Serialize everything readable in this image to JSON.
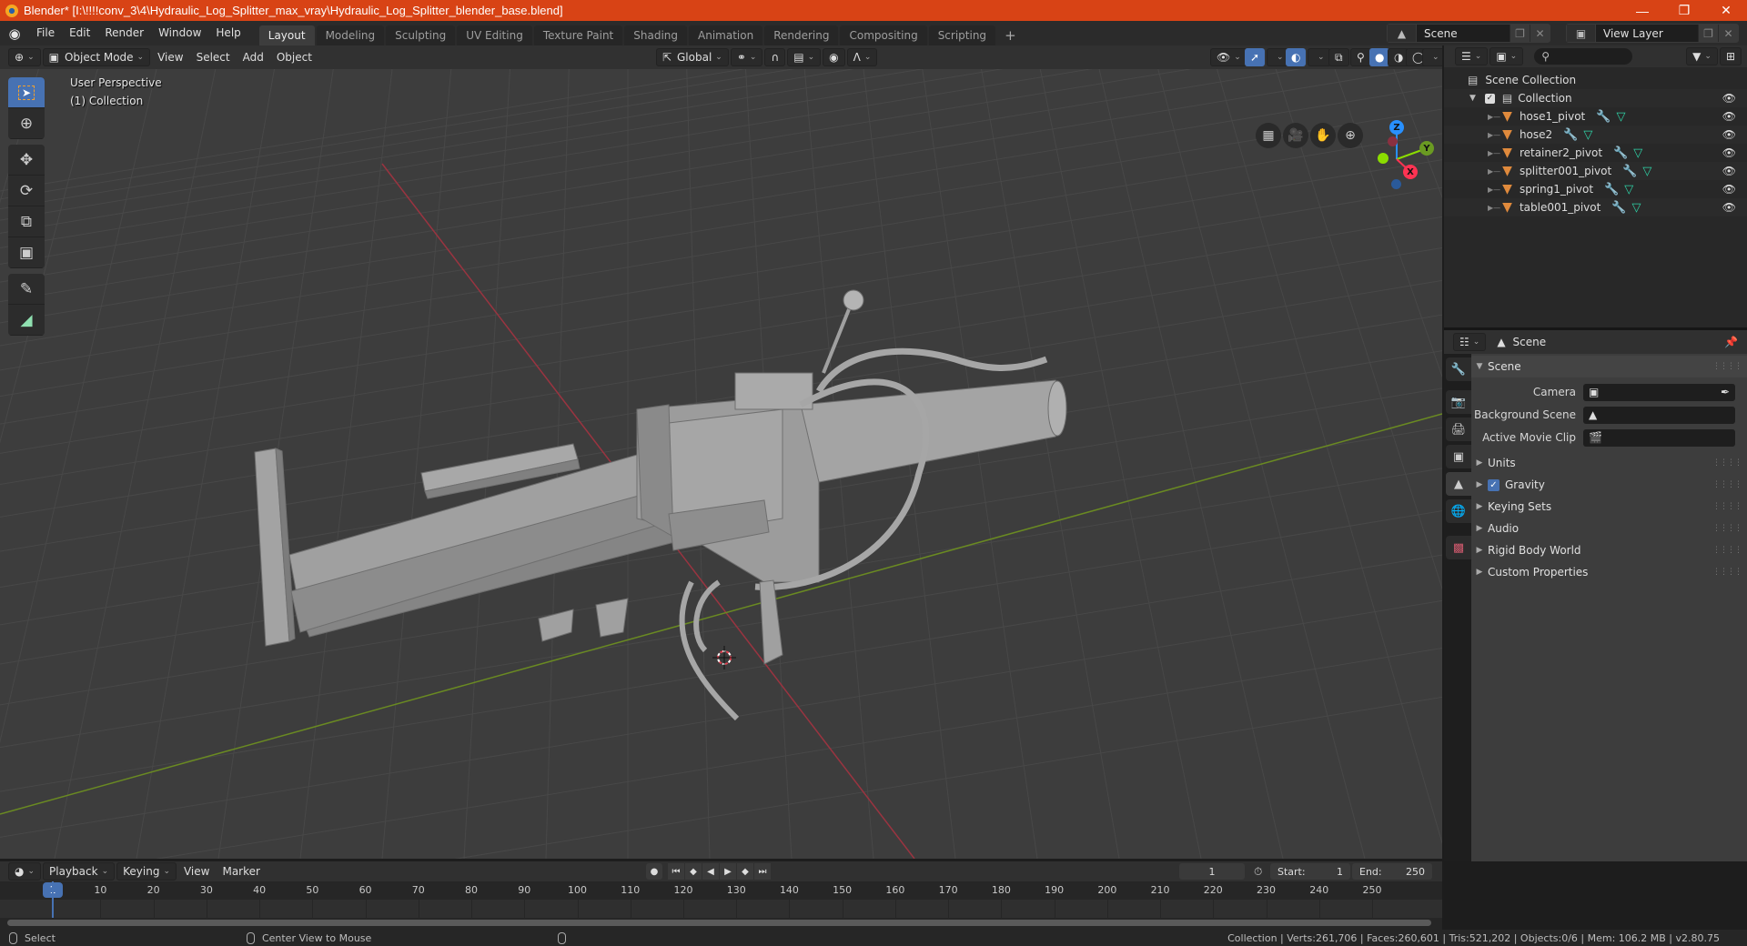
{
  "window": {
    "title": "Blender* [I:\\!!!!conv_3\\4\\Hydraulic_Log_Splitter_max_vray\\Hydraulic_Log_Splitter_blender_base.blend]",
    "controls": {
      "minimize": "—",
      "maximize": "❐",
      "close": "✕"
    }
  },
  "menubar": {
    "items": [
      "File",
      "Edit",
      "Render",
      "Window",
      "Help"
    ],
    "workspaces": [
      "Layout",
      "Modeling",
      "Sculpting",
      "UV Editing",
      "Texture Paint",
      "Shading",
      "Animation",
      "Rendering",
      "Compositing",
      "Scripting"
    ],
    "active_workspace": "Layout",
    "add_workspace": "+",
    "scene": "Scene",
    "view_layer": "View Layer"
  },
  "viewport": {
    "mode": "Object Mode",
    "menus": [
      "View",
      "Select",
      "Add",
      "Object"
    ],
    "transform_orientation": "Global",
    "overlay_text": [
      "User Perspective",
      "(1) Collection"
    ],
    "gizmo_axes": {
      "x": "X",
      "y": "Y",
      "z": "Z"
    },
    "axis_colors": {
      "x": "#ff3352",
      "y": "#8bdc00",
      "z": "#2890ff"
    },
    "object_color": "#9a9a9a"
  },
  "outliner": {
    "search_placeholder": "",
    "root": "Scene Collection",
    "collection": "Collection",
    "objects": [
      "hose1_pivot",
      "hose2",
      "retainer2_pivot",
      "splitter001_pivot",
      "spring1_pivot",
      "table001_pivot"
    ]
  },
  "properties": {
    "context": "Scene",
    "panel_title": "Scene",
    "fields": [
      {
        "label": "Camera",
        "value": ""
      },
      {
        "label": "Background Scene",
        "value": ""
      },
      {
        "label": "Active Movie Clip",
        "value": ""
      }
    ],
    "subpanels": [
      {
        "label": "Units"
      },
      {
        "label": "Gravity",
        "checked": true
      },
      {
        "label": "Keying Sets"
      },
      {
        "label": "Audio"
      },
      {
        "label": "Rigid Body World"
      },
      {
        "label": "Custom Properties"
      }
    ]
  },
  "timeline": {
    "menus": [
      "Playback",
      "Keying",
      "View",
      "Marker"
    ],
    "current_frame": "1",
    "start_label": "Start:",
    "start": "1",
    "end_label": "End:",
    "end": "250",
    "ticks": [
      "10",
      "20",
      "30",
      "40",
      "50",
      "60",
      "70",
      "80",
      "90",
      "100",
      "110",
      "120",
      "130",
      "140",
      "150",
      "160",
      "170",
      "180",
      "190",
      "200",
      "210",
      "220",
      "230",
      "240",
      "250"
    ]
  },
  "statusbar": {
    "left_action": "Select",
    "middle_action": "Center View to Mouse",
    "stats": "Collection | Verts:261,706 | Faces:260,601 | Tris:521,202 | Objects:0/6 | Mem: 106.2 MB | v2.80.75"
  }
}
